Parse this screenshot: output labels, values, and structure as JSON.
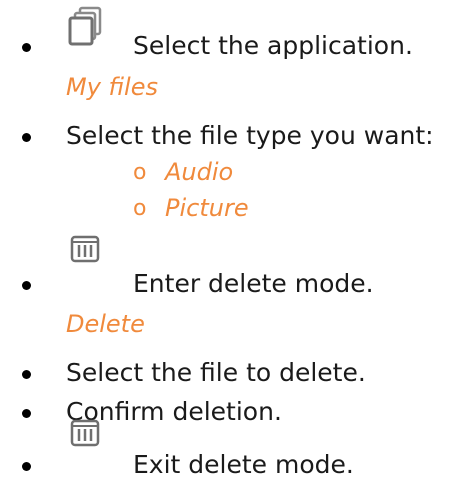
{
  "steps": [
    {
      "text": "Select the application.",
      "icon": "files-app-icon",
      "sub": "My files"
    },
    {
      "text": "Select the file type you want:",
      "options": [
        {
          "marker": "o",
          "label": "Audio"
        },
        {
          "marker": "o",
          "label": "Picture"
        }
      ]
    },
    {
      "text": "Enter delete mode.",
      "icon": "trash-bin-icon",
      "sub": "Delete"
    },
    {
      "text": "Select the file to delete."
    },
    {
      "text": "Confirm deletion."
    },
    {
      "text": "Exit delete mode.",
      "icon": "trash-bin-icon"
    }
  ],
  "colors": {
    "accent": "#f08a3c",
    "text": "#1a1a1a",
    "icon": "#707070"
  }
}
